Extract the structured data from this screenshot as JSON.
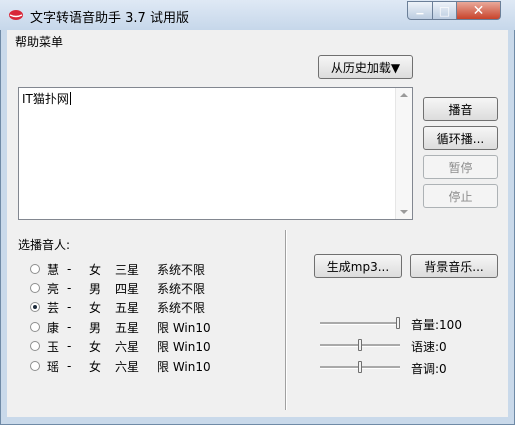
{
  "window": {
    "title": "文字转语音助手 3.7 试用版",
    "close_glyph": "✕",
    "min_glyph": "▁",
    "max_glyph": "□"
  },
  "menu": {
    "help": "帮助菜单"
  },
  "history_button": "从历史加载▼",
  "text_input": {
    "value": "IT猫扑网"
  },
  "buttons": {
    "play": "播音",
    "loop": "循环播...",
    "pause": "暂停",
    "stop": "停止",
    "mp3": "生成mp3...",
    "bgm": "背景音乐..."
  },
  "voice_section": {
    "label": "选播音人:"
  },
  "voices": [
    {
      "name": "慧",
      "sep": "-",
      "gender": "女",
      "stars": "三星",
      "limit": "系统不限",
      "selected": false
    },
    {
      "name": "亮",
      "sep": "-",
      "gender": "男",
      "stars": "四星",
      "limit": "系统不限",
      "selected": false
    },
    {
      "name": "芸",
      "sep": "-",
      "gender": "女",
      "stars": "五星",
      "limit": "系统不限",
      "selected": true
    },
    {
      "name": "康",
      "sep": "-",
      "gender": "男",
      "stars": "五星",
      "limit": "限 Win10",
      "selected": false
    },
    {
      "name": "玉",
      "sep": "-",
      "gender": "女",
      "stars": "六星",
      "limit": "限 Win10",
      "selected": false
    },
    {
      "name": "瑶",
      "sep": "-",
      "gender": "女",
      "stars": "六星",
      "limit": "限 Win10",
      "selected": false
    }
  ],
  "sliders": {
    "volume": {
      "label": "音量:100",
      "level": 1.0
    },
    "speed": {
      "label": "语速:0",
      "level": 0.5
    },
    "pitch": {
      "label": "音调:0",
      "level": 0.5
    }
  },
  "colors": {
    "title_bar": "#c6d7ea",
    "close_button": "#c8432b",
    "client": "#f0f0f0"
  }
}
